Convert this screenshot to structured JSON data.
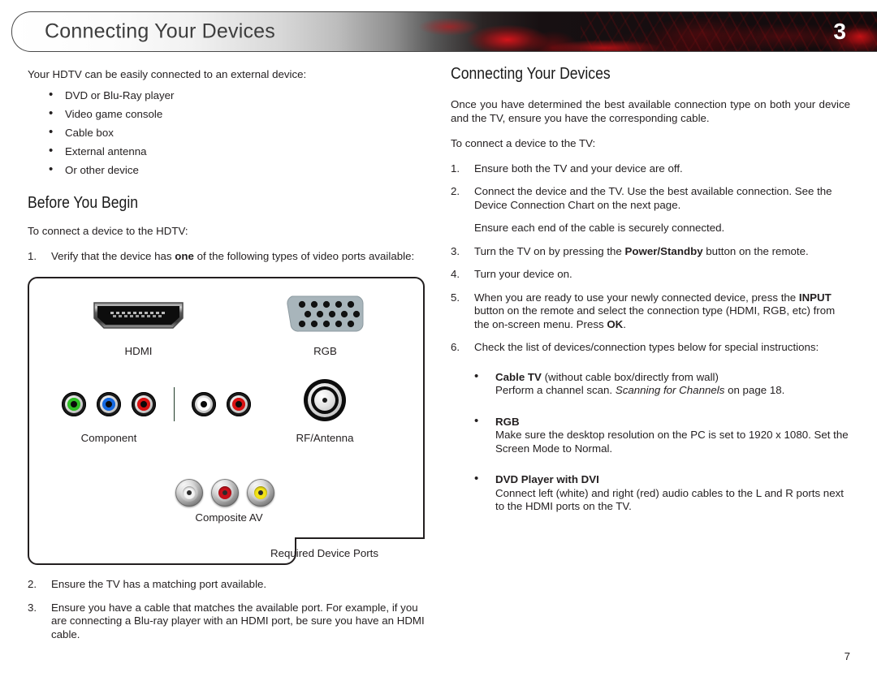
{
  "header": {
    "title": "Connecting Your Devices",
    "chapter_number": "3",
    "accent_color": "#d6121a",
    "bar_dark_color": "#120a0c"
  },
  "left_column": {
    "intro": "Your HDTV can be easily connected to an external device:",
    "device_bullets": [
      "DVD or Blu-Ray player",
      "Video game console",
      "Cable box",
      "External antenna",
      "Or other device"
    ],
    "heading": "Before You Begin",
    "lead_in": "To connect a device to the HDTV:",
    "steps": [
      {
        "num": "1.",
        "parts": [
          {
            "text": "Verify that the device has "
          },
          {
            "text": "one",
            "bold": true
          },
          {
            "text": " of the following types of video ports available:"
          }
        ]
      },
      {
        "num": "2.",
        "parts": [
          {
            "text": "Ensure the TV has a matching port available."
          }
        ]
      },
      {
        "num": "3.",
        "parts": [
          {
            "text": "Ensure you have a cable that matches the available port. For example, if you are connecting a Blu-ray player with an HDMI port, be sure you have an HDMI cable."
          }
        ]
      }
    ]
  },
  "port_diagram": {
    "tab_label": "Required Device Ports",
    "ports": [
      {
        "id": "hdmi",
        "caption": "HDMI"
      },
      {
        "id": "rgb",
        "caption": "RGB"
      },
      {
        "id": "component",
        "caption": "Component"
      },
      {
        "id": "rf-antenna",
        "caption": "RF/Antenna"
      },
      {
        "id": "composite-av",
        "caption": "Composite AV"
      }
    ],
    "component_jack_colors": [
      "#2fbe25",
      "#1569e0",
      "#d81212"
    ],
    "component_audio_jack_colors": [
      "#ffffff",
      "#d81212"
    ],
    "composite_jack_colors": [
      "#f2f2f2",
      "#c8101a",
      "#f2e318"
    ],
    "rgb_port_color": "#a8b5bb",
    "rgb_pin_rows": [
      5,
      5,
      5
    ]
  },
  "right_column": {
    "heading": "Connecting Your Devices",
    "intro": "Once you have determined the best available connection type on both your device and the TV, ensure you have the corresponding cable.",
    "lead_in": "To connect a device to the TV:",
    "steps": [
      {
        "num": "1.",
        "parts": [
          {
            "text": "Ensure both the TV and your device are off."
          }
        ],
        "sub": ""
      },
      {
        "num": "2.",
        "parts": [
          {
            "text": "Connect the device and the TV. Use the best available connection. See the Device Connection Chart on the next page."
          }
        ],
        "sub": "Ensure each end of the cable is securely connected."
      },
      {
        "num": "3.",
        "parts": [
          {
            "text": "Turn the TV on by pressing the "
          },
          {
            "text": "Power/Standby",
            "bold": true
          },
          {
            "text": " button on the remote."
          }
        ],
        "sub": ""
      },
      {
        "num": "4.",
        "parts": [
          {
            "text": "Turn your device on."
          }
        ],
        "sub": ""
      },
      {
        "num": "5.",
        "parts": [
          {
            "text": "When you are ready to use your newly connected device, press the "
          },
          {
            "text": "INPUT",
            "bold": true
          },
          {
            "text": " button on the remote and select the connection type (HDMI, RGB, etc) from the on-screen menu. Press "
          },
          {
            "text": "OK",
            "bold": true
          },
          {
            "text": "."
          }
        ],
        "sub": ""
      },
      {
        "num": "6.",
        "parts": [
          {
            "text": "Check the list of devices/connection types below for special instructions:"
          }
        ],
        "sub": ""
      }
    ],
    "special_instructions": [
      {
        "parts": [
          {
            "text": "Cable TV",
            "bold": true
          },
          {
            "text": " (without cable box/directly from wall)"
          },
          {
            "text": "\n"
          },
          {
            "text": "Perform a channel scan. "
          },
          {
            "text": "Scanning for Channels",
            "italic": true
          },
          {
            "text": " on page 18."
          }
        ]
      },
      {
        "parts": [
          {
            "text": "RGB",
            "bold": true
          },
          {
            "text": "\n"
          },
          {
            "text": "Make sure the desktop resolution on the PC is set to 1920 x 1080. Set the Screen Mode to Normal."
          }
        ]
      },
      {
        "parts": [
          {
            "text": "DVD Player with DVI",
            "bold": true
          },
          {
            "text": "\n"
          },
          {
            "text": "Connect left (white) and right (red) audio cables to the L and R ports next to the HDMI ports on the TV."
          }
        ]
      }
    ]
  },
  "footer": {
    "page_number": "7"
  }
}
